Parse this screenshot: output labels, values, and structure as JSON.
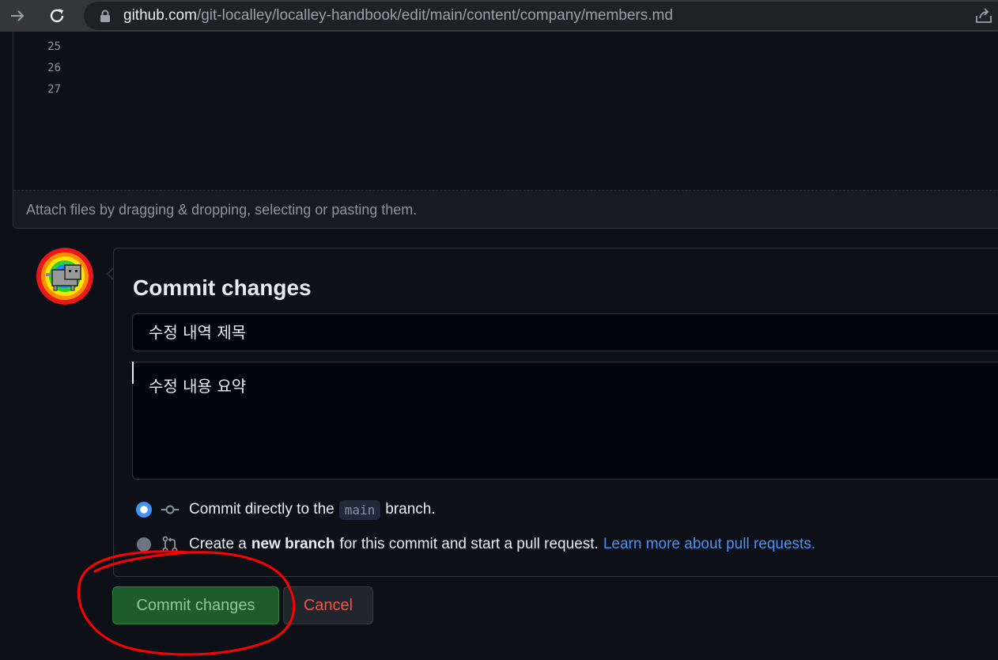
{
  "browser": {
    "url_host": "github.com",
    "url_path": "/git-localley/localley-handbook/edit/main/content/company/members.md"
  },
  "editor": {
    "line_numbers": [
      "25",
      "26",
      "27"
    ],
    "attach_hint": "Attach files by dragging & dropping, selecting or pasting them."
  },
  "commit": {
    "heading": "Commit changes",
    "title_value": "수정 내역 제목",
    "description_value": "수정 내용 요약",
    "option_direct": {
      "prefix": "Commit directly to the",
      "branch": "main",
      "suffix": "branch."
    },
    "option_new_branch": {
      "prefix": "Create a",
      "bold": "new branch",
      "suffix": "for this commit and start a pull request.",
      "link": "Learn more about pull requests."
    },
    "selected_option": "direct",
    "commit_button": "Commit changes",
    "cancel_button": "Cancel"
  },
  "colors": {
    "background": "#0d1117",
    "accent_blue": "#4493f8",
    "commit_green": "#1e5c2b",
    "cancel_red": "#f85149",
    "annotation_red": "#ff0000"
  },
  "icons": [
    "forward-arrow-icon",
    "reload-icon",
    "lock-icon",
    "share-icon",
    "git-commit-icon",
    "git-pull-request-icon"
  ]
}
